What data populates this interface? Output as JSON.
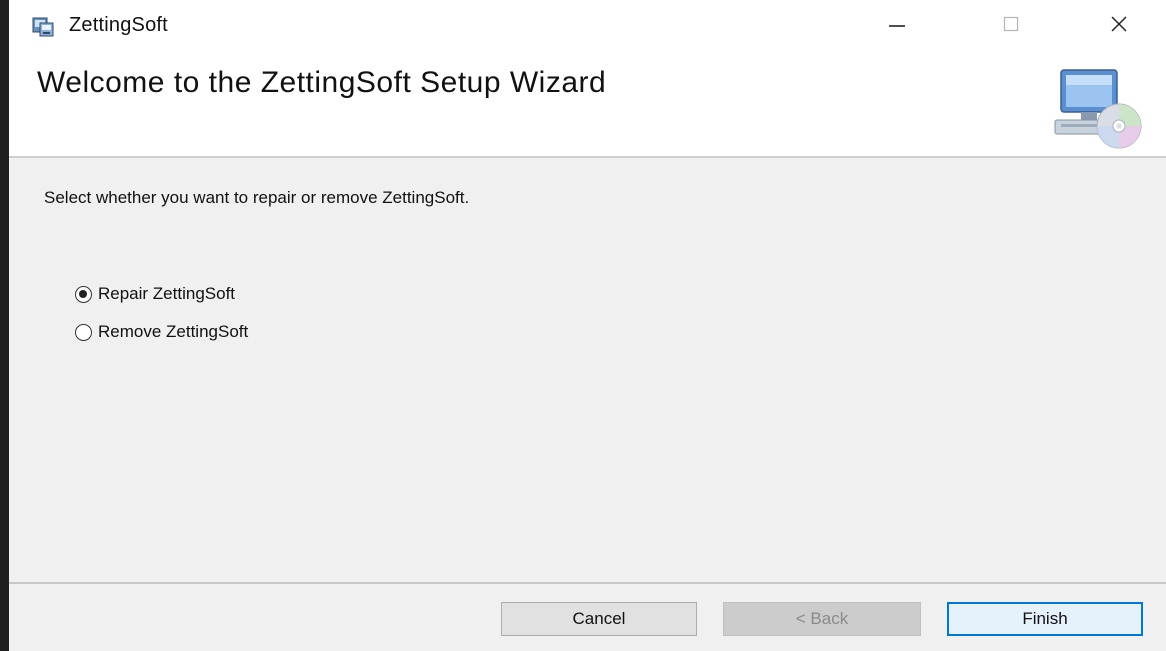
{
  "window": {
    "title": "ZettingSoft"
  },
  "banner": {
    "title": "Welcome to the ZettingSoft Setup Wizard"
  },
  "content": {
    "instruction": "Select whether you want to repair or remove ZettingSoft.",
    "options": [
      {
        "label": "Repair ZettingSoft",
        "selected": true
      },
      {
        "label": "Remove ZettingSoft",
        "selected": false
      }
    ]
  },
  "footer": {
    "cancel_label": "Cancel",
    "back_label": "< Back",
    "back_enabled": false,
    "finish_label": "Finish"
  },
  "icons": {
    "app": "installer-icon",
    "banner": "computer-cd-icon",
    "minimize": "minimize-icon",
    "maximize": "maximize-icon",
    "close": "close-icon"
  },
  "colors": {
    "accent": "#0078d7",
    "content_bg": "#f0f0f0"
  }
}
